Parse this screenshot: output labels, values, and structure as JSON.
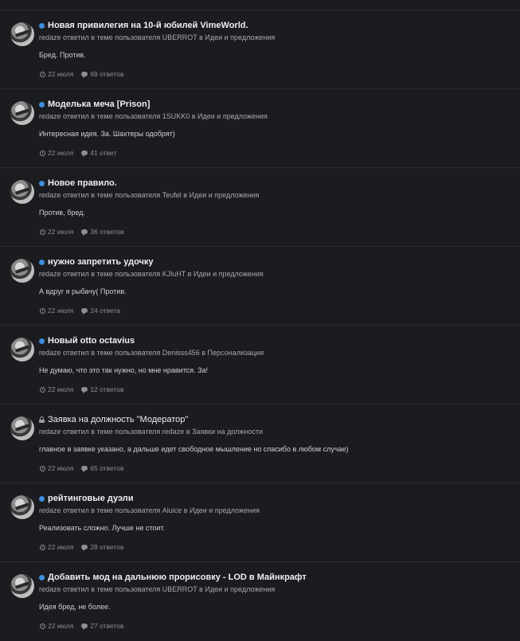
{
  "items": [
    {
      "status_icon": "unread-dot-icon",
      "title": "Новая привилегия на 10-й юбилей VimeWorld.",
      "subline": "redaze ответил в теме пользователя UBERROT в Идеи и предложения",
      "text": "Бред. Против.",
      "date": "22 июля",
      "replies": "69 ответов"
    },
    {
      "status_icon": "unread-dot-icon",
      "title": "Моделька меча [Prison]",
      "subline": "redaze ответил в теме пользователя 1SUKK0 в Идеи и предложения",
      "text": "Интересная идея. За. Шахтеры одобрят)",
      "date": "22 июля",
      "replies": "41 ответ"
    },
    {
      "status_icon": "unread-dot-icon",
      "title": "Новое правило.",
      "subline": "redaze ответил в теме пользователя Teufel в Идеи и предложения",
      "text": "Против, бред.",
      "date": "22 июля",
      "replies": "36 ответов"
    },
    {
      "status_icon": "unread-dot-icon",
      "title": "нужно запретить удочку",
      "subline": "redaze ответил в теме пользователя KJluHT в Идеи и предложения",
      "text": "А вдруг я рыбачу( Против.",
      "date": "22 июля",
      "replies": "24 ответа"
    },
    {
      "status_icon": "unread-dot-icon",
      "title": "Новый otto octavius",
      "subline": "redaze ответил в теме пользователя Denisss456 в Персонализация",
      "text": "Не думаю, что это так нужно, но мне нравится. За!",
      "date": "22 июля",
      "replies": "12 ответов"
    },
    {
      "status_icon": "lock-icon",
      "title": "Заявка на должность \"Модератор\"",
      "subline": "redaze ответил в теме пользователя redaze в Заявки на должности",
      "text": "главное в заявке указано, а дальше идет свободное мышление но спасибо в любом случае)",
      "date": "22 июля",
      "replies": "65 ответов"
    },
    {
      "status_icon": "unread-dot-icon",
      "title": "рейтинговые дуэли",
      "subline": "redaze ответил в теме пользователя Aluice в Идеи и предложения",
      "text": "Реализовать сложно. Лучше не стоит.",
      "date": "22 июля",
      "replies": "28 ответов"
    },
    {
      "status_icon": "unread-dot-icon",
      "title": "Добавить мод на дальнюю прорисовку - LOD в Майнкрафт",
      "subline": "redaze ответил в теме пользователя UBERROT в Идеи и предложения",
      "text": "Идея бред, не более.",
      "date": "22 июля",
      "replies": "27 ответов"
    }
  ],
  "colors": {
    "background": "#1b1c1f",
    "unread_dot": "#3d8ede",
    "title": "#eeeff1",
    "muted": "#8d8e93"
  }
}
